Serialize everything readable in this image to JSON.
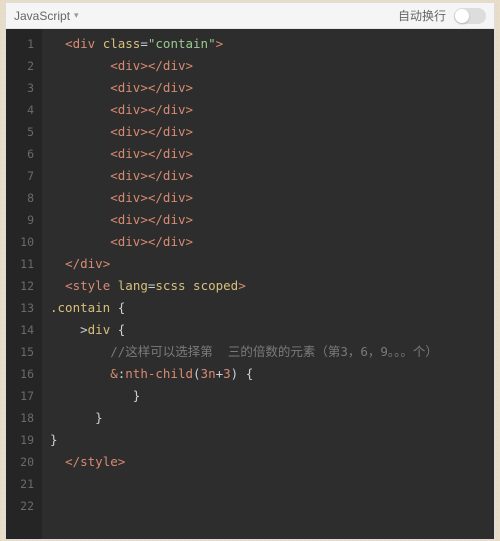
{
  "toolbar": {
    "language": "JavaScript",
    "wrap_label": "自动换行"
  },
  "code_lines": [
    {
      "n": 1,
      "indent": 1,
      "segs": [
        {
          "t": "<",
          "c": "tag"
        },
        {
          "t": "div",
          "c": "tag"
        },
        {
          "t": " ",
          "c": "punct"
        },
        {
          "t": "class",
          "c": "attr"
        },
        {
          "t": "=",
          "c": "punct"
        },
        {
          "t": "\"contain\"",
          "c": "str"
        },
        {
          "t": ">",
          "c": "tag"
        }
      ]
    },
    {
      "n": 2,
      "indent": 4,
      "segs": [
        {
          "t": "<",
          "c": "tag"
        },
        {
          "t": "div",
          "c": "tag"
        },
        {
          "t": ">",
          "c": "tag"
        },
        {
          "t": "</",
          "c": "tag"
        },
        {
          "t": "div",
          "c": "tag"
        },
        {
          "t": ">",
          "c": "tag"
        }
      ]
    },
    {
      "n": 3,
      "indent": 4,
      "segs": [
        {
          "t": "<",
          "c": "tag"
        },
        {
          "t": "div",
          "c": "tag"
        },
        {
          "t": ">",
          "c": "tag"
        },
        {
          "t": "</",
          "c": "tag"
        },
        {
          "t": "div",
          "c": "tag"
        },
        {
          "t": ">",
          "c": "tag"
        }
      ]
    },
    {
      "n": 4,
      "indent": 4,
      "segs": [
        {
          "t": "<",
          "c": "tag"
        },
        {
          "t": "div",
          "c": "tag"
        },
        {
          "t": ">",
          "c": "tag"
        },
        {
          "t": "</",
          "c": "tag"
        },
        {
          "t": "div",
          "c": "tag"
        },
        {
          "t": ">",
          "c": "tag"
        }
      ]
    },
    {
      "n": 5,
      "indent": 4,
      "segs": [
        {
          "t": "<",
          "c": "tag"
        },
        {
          "t": "div",
          "c": "tag"
        },
        {
          "t": ">",
          "c": "tag"
        },
        {
          "t": "</",
          "c": "tag"
        },
        {
          "t": "div",
          "c": "tag"
        },
        {
          "t": ">",
          "c": "tag"
        }
      ]
    },
    {
      "n": 6,
      "indent": 4,
      "segs": [
        {
          "t": "<",
          "c": "tag"
        },
        {
          "t": "div",
          "c": "tag"
        },
        {
          "t": ">",
          "c": "tag"
        },
        {
          "t": "</",
          "c": "tag"
        },
        {
          "t": "div",
          "c": "tag"
        },
        {
          "t": ">",
          "c": "tag"
        }
      ]
    },
    {
      "n": 7,
      "indent": 4,
      "segs": [
        {
          "t": "<",
          "c": "tag"
        },
        {
          "t": "div",
          "c": "tag"
        },
        {
          "t": ">",
          "c": "tag"
        },
        {
          "t": "</",
          "c": "tag"
        },
        {
          "t": "div",
          "c": "tag"
        },
        {
          "t": ">",
          "c": "tag"
        }
      ]
    },
    {
      "n": 8,
      "indent": 4,
      "segs": [
        {
          "t": "<",
          "c": "tag"
        },
        {
          "t": "div",
          "c": "tag"
        },
        {
          "t": ">",
          "c": "tag"
        },
        {
          "t": "</",
          "c": "tag"
        },
        {
          "t": "div",
          "c": "tag"
        },
        {
          "t": ">",
          "c": "tag"
        }
      ]
    },
    {
      "n": 9,
      "indent": 4,
      "segs": [
        {
          "t": "<",
          "c": "tag"
        },
        {
          "t": "div",
          "c": "tag"
        },
        {
          "t": ">",
          "c": "tag"
        },
        {
          "t": "</",
          "c": "tag"
        },
        {
          "t": "div",
          "c": "tag"
        },
        {
          "t": ">",
          "c": "tag"
        }
      ]
    },
    {
      "n": 10,
      "indent": 4,
      "segs": [
        {
          "t": "<",
          "c": "tag"
        },
        {
          "t": "div",
          "c": "tag"
        },
        {
          "t": ">",
          "c": "tag"
        },
        {
          "t": "</",
          "c": "tag"
        },
        {
          "t": "div",
          "c": "tag"
        },
        {
          "t": ">",
          "c": "tag"
        }
      ]
    },
    {
      "n": 11,
      "indent": 1,
      "segs": [
        {
          "t": "</",
          "c": "tag"
        },
        {
          "t": "div",
          "c": "tag"
        },
        {
          "t": ">",
          "c": "tag"
        }
      ]
    },
    {
      "n": 12,
      "indent": 1,
      "segs": [
        {
          "t": "<",
          "c": "tag"
        },
        {
          "t": "style",
          "c": "tag"
        },
        {
          "t": " ",
          "c": "punct"
        },
        {
          "t": "lang",
          "c": "attr"
        },
        {
          "t": "=",
          "c": "punct"
        },
        {
          "t": "scss",
          "c": "sel"
        },
        {
          "t": " ",
          "c": "punct"
        },
        {
          "t": "scoped",
          "c": "sel"
        },
        {
          "t": ">",
          "c": "tag"
        }
      ]
    },
    {
      "n": 13,
      "indent": 0,
      "segs": [
        {
          "t": ".contain",
          "c": "sel"
        },
        {
          "t": " {",
          "c": "brace"
        }
      ]
    },
    {
      "n": 14,
      "indent": 2,
      "segs": [
        {
          "t": ">",
          "c": "punct"
        },
        {
          "t": "div",
          "c": "sel"
        },
        {
          "t": " {",
          "c": "brace"
        }
      ]
    },
    {
      "n": 15,
      "indent": 4,
      "segs": [
        {
          "t": "//这样可以选择第  三的倍数的元素（第3，6，9。。。个）",
          "c": "comm"
        }
      ]
    },
    {
      "n": 16,
      "indent": 4,
      "segs": [
        {
          "t": "&",
          "c": "amp"
        },
        {
          "t": ":",
          "c": "colon"
        },
        {
          "t": "nth-child",
          "c": "prop"
        },
        {
          "t": "(",
          "c": "punct"
        },
        {
          "t": "3n",
          "c": "num"
        },
        {
          "t": "+",
          "c": "plus"
        },
        {
          "t": "3",
          "c": "num"
        },
        {
          "t": ")",
          "c": "punct"
        },
        {
          "t": " {",
          "c": "brace"
        }
      ]
    },
    {
      "n": 17,
      "indent": 4,
      "segs": [
        {
          "t": "   }",
          "c": "brace"
        }
      ]
    },
    {
      "n": 18,
      "indent": 2,
      "segs": [
        {
          "t": "  }",
          "c": "brace"
        }
      ]
    },
    {
      "n": 19,
      "indent": 0,
      "segs": [
        {
          "t": "}",
          "c": "brace"
        }
      ]
    },
    {
      "n": 20,
      "indent": 1,
      "segs": [
        {
          "t": "</",
          "c": "tag"
        },
        {
          "t": "style",
          "c": "tag"
        },
        {
          "t": ">",
          "c": "tag"
        }
      ]
    },
    {
      "n": 21,
      "indent": 0,
      "segs": []
    },
    {
      "n": 22,
      "indent": 0,
      "segs": []
    }
  ]
}
